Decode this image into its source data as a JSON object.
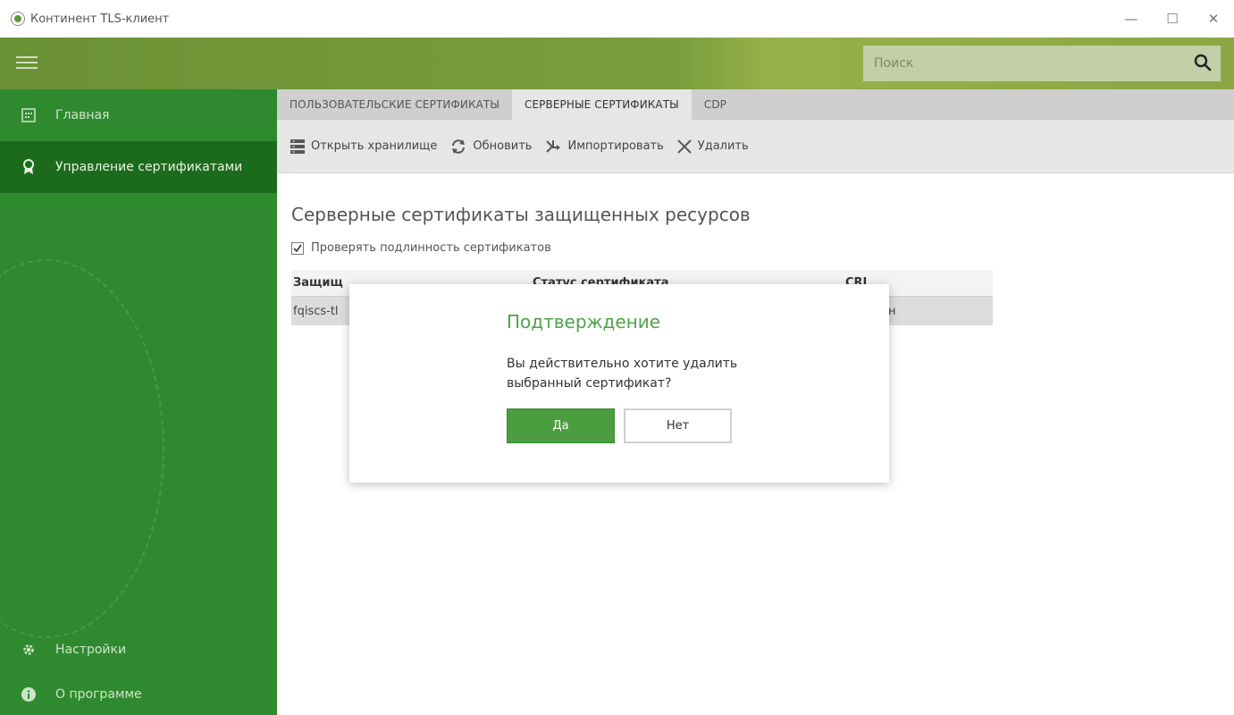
{
  "window": {
    "title": "Континент TLS-клиент",
    "minimize_glyph": "—",
    "maximize_glyph": "☐",
    "close_glyph": "✕"
  },
  "header": {
    "search_placeholder": "Поиск"
  },
  "sidebar": {
    "items": [
      {
        "label": "Главная",
        "icon": "calendar-grid-icon"
      },
      {
        "label": "Управление сертификатами",
        "icon": "award-ribbon-icon",
        "active": true
      },
      {
        "label": "Настройки",
        "icon": "gear-icon"
      },
      {
        "label": "О программе",
        "icon": "info-icon"
      }
    ]
  },
  "tabs": [
    {
      "label": "ПОЛЬЗОВАТЕЛЬСКИЕ СЕРТИФИКАТЫ",
      "active": false
    },
    {
      "label": "СЕРВЕРНЫЕ СЕРТИФИКАТЫ",
      "active": true
    },
    {
      "label": "CDP",
      "active": false
    }
  ],
  "toolbar": {
    "open_storage": "Открыть хранилище",
    "refresh": "Обновить",
    "import": "Импортировать",
    "delete": "Удалить"
  },
  "main": {
    "title": "Серверные сертификаты защищенных ресурсов",
    "verify_label": "Проверять подлинность сертификатов",
    "verify_checked": true,
    "table": {
      "headers": [
        "Защищ",
        "Статус сертификата",
        "CRL"
      ],
      "rows": [
        [
          "fqiscs-tl",
          "",
          "вителен"
        ]
      ]
    }
  },
  "dialog": {
    "title": "Подтверждение",
    "message": "Вы действительно хотите удалить выбранный сертификат?",
    "yes_label": "Да",
    "no_label": "Нет"
  },
  "colors": {
    "sidebar": "#2f8a2f",
    "sidebar_active": "#1c6b1c",
    "accent_green": "#4a9e3f",
    "dialog_title": "#4fa34a"
  }
}
